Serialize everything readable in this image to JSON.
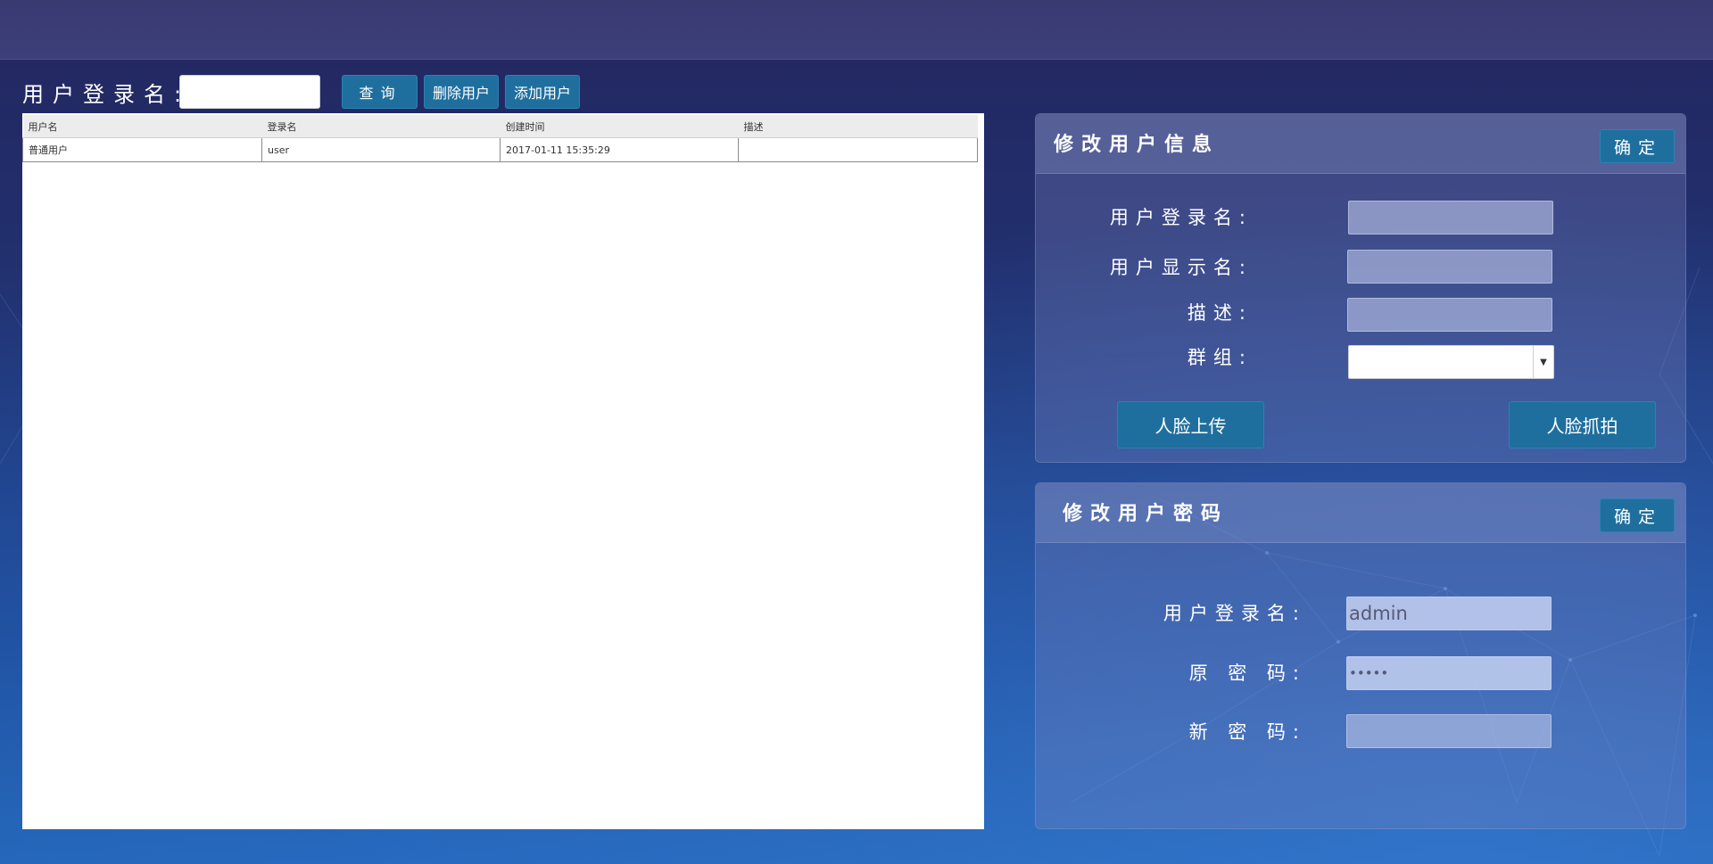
{
  "search": {
    "label": "用户登录名:",
    "value": "",
    "query_button": "查询",
    "delete_button": "删除用户",
    "add_button": "添加用户"
  },
  "table": {
    "columns": [
      "用户名",
      "登录名",
      "创建时间",
      "描述"
    ],
    "rows": [
      [
        "普通用户",
        "user",
        "2017-01-11 15:35:29",
        ""
      ]
    ]
  },
  "edit_info": {
    "title": "修改用户信息",
    "confirm_button": "确定",
    "login_name_label": "用户登录名:",
    "login_name_value": "",
    "display_name_label": "用户显示名:",
    "display_name_value": "",
    "description_label": "描述:",
    "description_value": "",
    "group_label": "群组:",
    "group_value": "",
    "face_upload_button": "人脸上传",
    "face_capture_button": "人脸抓拍"
  },
  "edit_password": {
    "title": "修改用户密码",
    "confirm_button": "确定",
    "login_name_label": "用户登录名:",
    "login_name_value": "admin",
    "old_password_label": "原 密 码:",
    "old_password_value": "•••••",
    "new_password_label": "新 密 码:",
    "new_password_value": ""
  }
}
